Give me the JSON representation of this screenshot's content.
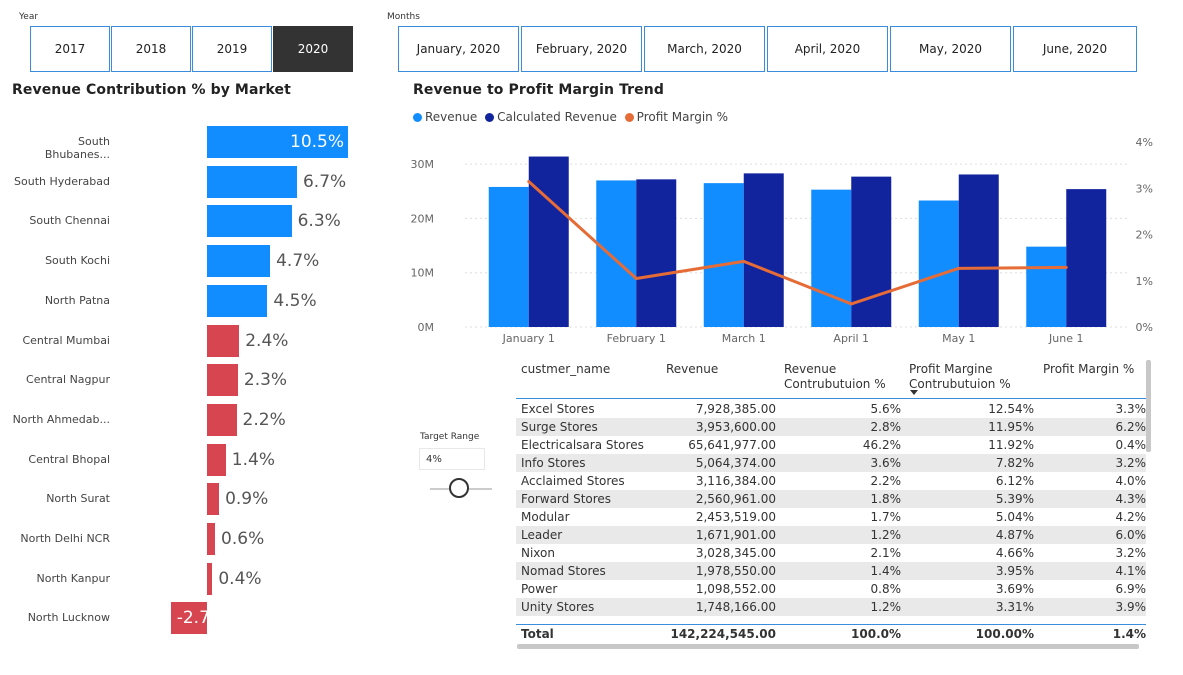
{
  "year_slicer": {
    "title": "Year",
    "options": [
      "2017",
      "2018",
      "2019",
      "2020"
    ],
    "selected": "2020"
  },
  "month_slicer": {
    "title": "Months",
    "options": [
      "January, 2020",
      "February, 2020",
      "March, 2020",
      "April, 2020",
      "May, 2020",
      "June, 2020"
    ]
  },
  "market_chart": {
    "title": "Revenue Contribution % by Market",
    "rows": [
      {
        "label": "South Bhubanes...",
        "value": 10.5,
        "text": "10.5%",
        "color": "#118dff"
      },
      {
        "label": "South Hyderabad",
        "value": 6.7,
        "text": "6.7%",
        "color": "#118dff"
      },
      {
        "label": "South Chennai",
        "value": 6.3,
        "text": "6.3%",
        "color": "#118dff"
      },
      {
        "label": "South Kochi",
        "value": 4.7,
        "text": "4.7%",
        "color": "#118dff"
      },
      {
        "label": "North Patna",
        "value": 4.5,
        "text": "4.5%",
        "color": "#118dff"
      },
      {
        "label": "Central Mumbai",
        "value": 2.4,
        "text": "2.4%",
        "color": "#d64550"
      },
      {
        "label": "Central Nagpur",
        "value": 2.3,
        "text": "2.3%",
        "color": "#d64550"
      },
      {
        "label": "North Ahmedab...",
        "value": 2.2,
        "text": "2.2%",
        "color": "#d64550"
      },
      {
        "label": "Central Bhopal",
        "value": 1.4,
        "text": "1.4%",
        "color": "#d64550"
      },
      {
        "label": "North Surat",
        "value": 0.9,
        "text": "0.9%",
        "color": "#d64550"
      },
      {
        "label": "North Delhi NCR",
        "value": 0.6,
        "text": "0.6%",
        "color": "#d64550"
      },
      {
        "label": "North Kanpur",
        "value": 0.4,
        "text": "0.4%",
        "color": "#d64550"
      },
      {
        "label": "North Lucknow",
        "value": -2.7,
        "text": "-2.7",
        "color": "#d64550"
      }
    ]
  },
  "chart_data": {
    "type": "bar",
    "title": "Revenue to Profit Margin Trend",
    "categories": [
      "January 1",
      "February 1",
      "March 1",
      "April 1",
      "May 1",
      "June 1"
    ],
    "series": [
      {
        "name": "Revenue",
        "color": "#118dff",
        "values": [
          25.8,
          27.0,
          26.5,
          25.3,
          23.3,
          14.8
        ]
      },
      {
        "name": "Calculated Revenue",
        "color": "#12239e",
        "values": [
          31.4,
          27.2,
          28.3,
          27.7,
          28.1,
          25.4
        ]
      },
      {
        "name": "Profit Margin %",
        "color": "#e66c37",
        "type": "line",
        "axis": "right",
        "values": [
          3.15,
          1.05,
          1.42,
          0.5,
          1.27,
          1.29
        ]
      }
    ],
    "y_ticks": [
      "0M",
      "10M",
      "20M",
      "30M"
    ],
    "ylim": [
      0,
      35
    ],
    "y2_ticks": [
      "0%",
      "1%",
      "2%",
      "3%",
      "4%"
    ],
    "y2lim": [
      0,
      4.2
    ]
  },
  "target_range": {
    "label": "Target Range",
    "value": "4%"
  },
  "table": {
    "headers": [
      "custmer_name",
      "Revenue",
      "Revenue Contrubutuion %",
      "Profit Margine Contrubutuion %",
      "Profit Margin %"
    ],
    "rows": [
      [
        "Excel Stores",
        "7,928,385.00",
        "5.6%",
        "12.54%",
        "3.3%"
      ],
      [
        "Surge Stores",
        "3,953,600.00",
        "2.8%",
        "11.95%",
        "6.2%"
      ],
      [
        "Electricalsara Stores",
        "65,641,977.00",
        "46.2%",
        "11.92%",
        "0.4%"
      ],
      [
        "Info Stores",
        "5,064,374.00",
        "3.6%",
        "7.82%",
        "3.2%"
      ],
      [
        "Acclaimed Stores",
        "3,116,384.00",
        "2.2%",
        "6.12%",
        "4.0%"
      ],
      [
        "Forward Stores",
        "2,560,961.00",
        "1.8%",
        "5.39%",
        "4.3%"
      ],
      [
        "Modular",
        "2,453,519.00",
        "1.7%",
        "5.04%",
        "4.2%"
      ],
      [
        "Leader",
        "1,671,901.00",
        "1.2%",
        "4.87%",
        "6.0%"
      ],
      [
        "Nixon",
        "3,028,345.00",
        "2.1%",
        "4.66%",
        "3.2%"
      ],
      [
        "Nomad Stores",
        "1,978,550.00",
        "1.4%",
        "3.95%",
        "4.1%"
      ],
      [
        "Power",
        "1,098,552.00",
        "0.8%",
        "3.69%",
        "6.9%"
      ],
      [
        "Unity Stores",
        "1,748,166.00",
        "1.2%",
        "3.31%",
        "3.9%"
      ]
    ],
    "total": [
      "Total",
      "142,224,545.00",
      "100.0%",
      "100.00%",
      "1.4%"
    ]
  }
}
